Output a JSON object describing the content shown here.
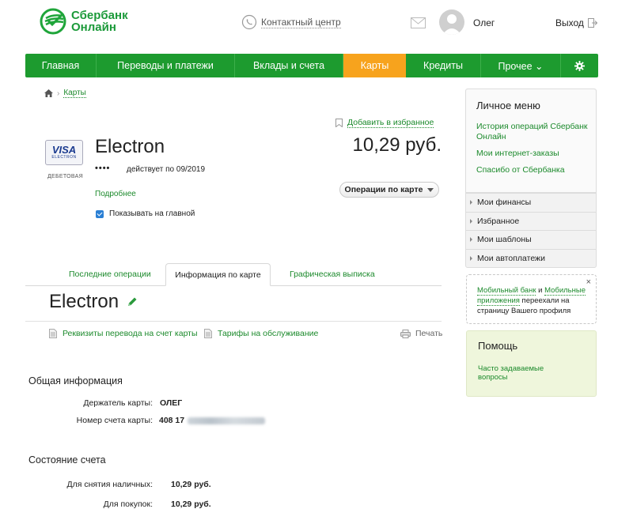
{
  "header": {
    "logo_line1": "Сбербанк",
    "logo_line2": "Онлайн",
    "contact_center": "Контактный центр",
    "username": "Олег",
    "logout": "Выход"
  },
  "nav": {
    "items": [
      {
        "label": "Главная"
      },
      {
        "label": "Переводы и платежи"
      },
      {
        "label": "Вклады и счета"
      },
      {
        "label": "Карты"
      },
      {
        "label": "Кредиты"
      },
      {
        "label": "Прочее ⌄"
      }
    ],
    "active": "Карты"
  },
  "breadcrumb": {
    "current": "Карты"
  },
  "card": {
    "favorite": "Добавить в избранное",
    "brand_main": "VISA",
    "brand_sub": "ELECTRON",
    "type_label": "ДЕБЕТОВАЯ",
    "title": "Electron",
    "mask": "••••",
    "valid": "действует по 09/2019",
    "details": "Подробнее",
    "balance": "10,29 руб.",
    "ops_button": "Операции по карте",
    "show_main": "Показывать на главной",
    "show_main_checked": true
  },
  "tabs": {
    "items": [
      {
        "label": "Последние операции"
      },
      {
        "label": "Информация по карте"
      },
      {
        "label": "Графическая выписка"
      }
    ],
    "active": "Информация по карте"
  },
  "info": {
    "title": "Electron",
    "link_requisites": "Реквизиты перевода на счет карты",
    "link_tariffs": "Тарифы на обслуживание",
    "print": "Печать",
    "general_title": "Общая информация",
    "holder_label": "Держатель карты:",
    "holder_value": "ОЛЕГ",
    "account_label": "Номер счета карты:",
    "account_value": "408 17",
    "state_title": "Состояние счета",
    "cash_label": "Для снятия наличных:",
    "cash_value": "10,29 руб.",
    "purchase_label": "Для покупок:",
    "purchase_value": "10,29 руб."
  },
  "sidebar": {
    "menu_title": "Личное меню",
    "links": [
      {
        "label": "История операций Сбербанк Онлайн"
      },
      {
        "label": "Мои интернет-заказы"
      },
      {
        "label": "Спасибо от Сбербанка"
      }
    ],
    "rows": [
      {
        "label": "Мои финансы"
      },
      {
        "label": "Избранное"
      },
      {
        "label": "Мои шаблоны"
      },
      {
        "label": "Мои автоплатежи"
      }
    ],
    "notice": {
      "link1": "Мобильный банк",
      "and": " и ",
      "link2": "Мобильные приложения",
      "rest": " переехали на страницу Вашего профиля",
      "close": "×"
    },
    "help_title": "Помощь",
    "help_link": "Часто задаваемые вопросы"
  },
  "colors": {
    "brand_green": "#1d9b2f",
    "active_tab_orange": "#f7a31d",
    "link_green": "#1c8a2c",
    "help_bg": "#eff6dc"
  }
}
